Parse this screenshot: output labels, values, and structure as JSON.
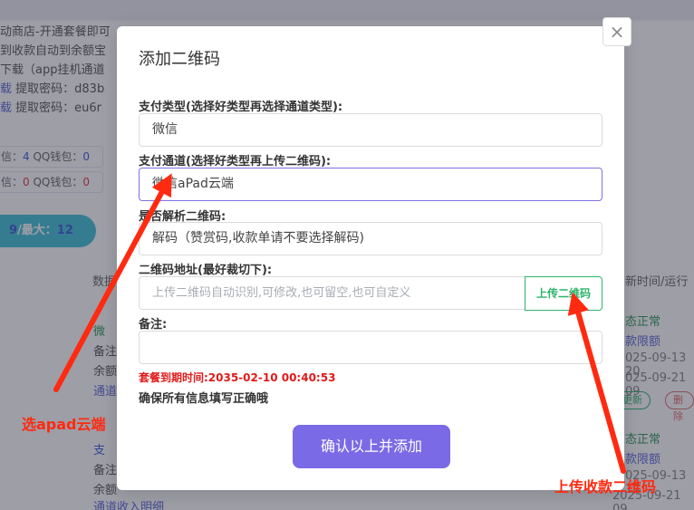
{
  "background": {
    "lines": [
      "动商店-开通套餐即可",
      "到收款自动到余额宝",
      "下载（app挂机通道",
      "载 提取密码：d83b",
      "载 提取密码：eu6r"
    ],
    "wallet_rows": [
      {
        "prefix": "信：",
        "count": "4",
        "label": "QQ钱包：",
        "value": "0"
      },
      {
        "prefix": "信：",
        "count": "0",
        "label": "QQ钱包：",
        "value": "0"
      }
    ],
    "pill": {
      "current": "9",
      "sep": "/最大：",
      "max": "12"
    },
    "col_left": "数据",
    "col_right": "新时间/运行",
    "row1": {
      "name": "微",
      "remark": "备注",
      "balance": "余额",
      "link": "通道"
    },
    "row2": {
      "name": "支",
      "remark": "备注",
      "balance": "余额",
      "link": "通道收入明细"
    },
    "status1": "态正常",
    "limit1": "款限额",
    "date1a": "025-09-13 20",
    "date1b": "025-09-21 09",
    "tag_update": "更新",
    "tag_delete": "删除",
    "status2": "态正常",
    "limit2": "款限额",
    "date2a": "025-09-13 17",
    "date2b": "2025-09-21 09"
  },
  "modal": {
    "title": "添加二维码",
    "close_label": "×",
    "pay_type_label": "支付类型(选择好类型再选择通道类型):",
    "pay_type_value": "微信",
    "channel_label": "支付通道(选择好类型再上传二维码):",
    "channel_value": "微信aPad云端",
    "parse_label": "是否解析二维码:",
    "parse_value": "解码（赞赏码,收款单请不要选择解码)",
    "qr_label": "二维码地址(最好裁切下):",
    "qr_placeholder": "上传二维码自动识别,可修改,也可留空,也可自定义",
    "upload_label": "上传二维码",
    "remark_label": "备注:",
    "remark_value": "",
    "expire_text": "套餐到期时间:2035-02-10 00:40:53",
    "hint_text": "确保所有信息填写正确哦",
    "submit_label": "确认以上并添加"
  },
  "annotations": {
    "left_text": "选apad云端",
    "right_text": "上传收款二维码",
    "color": "#ff2a10"
  }
}
